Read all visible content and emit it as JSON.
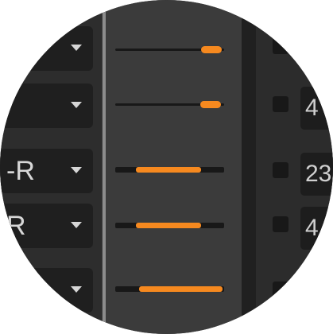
{
  "rows": [
    {
      "dropdown_label": "",
      "slider_value": 0.95,
      "numeric_text": ""
    },
    {
      "dropdown_label": "",
      "slider_value": 0.93,
      "numeric_text": "4"
    },
    {
      "dropdown_label": "-R",
      "slider_value": 0.7,
      "numeric_text": "23"
    },
    {
      "dropdown_label": "R",
      "slider_value": 0.7,
      "numeric_text": "4"
    },
    {
      "dropdown_label": "",
      "slider_value": 0.75,
      "numeric_text": ""
    }
  ],
  "colors": {
    "accent": "#f6891f",
    "panel_dark": "#1f1f1f",
    "panel": "#2d2d2d",
    "panel_mid": "#3b3b3b"
  }
}
